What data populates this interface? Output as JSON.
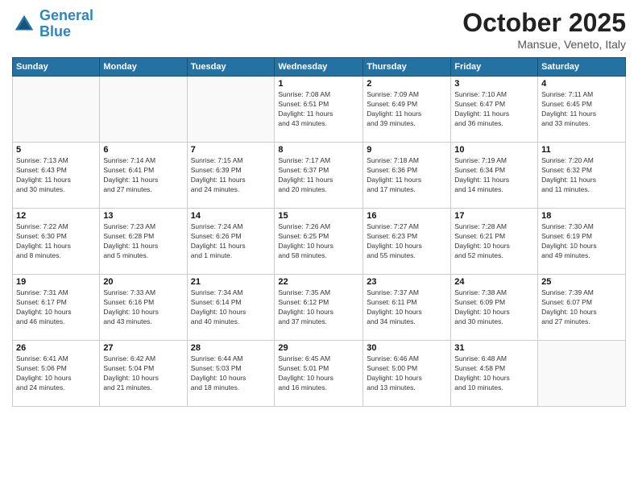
{
  "header": {
    "logo_line1": "General",
    "logo_line2": "Blue",
    "month": "October 2025",
    "location": "Mansue, Veneto, Italy"
  },
  "weekdays": [
    "Sunday",
    "Monday",
    "Tuesday",
    "Wednesday",
    "Thursday",
    "Friday",
    "Saturday"
  ],
  "weeks": [
    [
      {
        "day": "",
        "info": ""
      },
      {
        "day": "",
        "info": ""
      },
      {
        "day": "",
        "info": ""
      },
      {
        "day": "1",
        "info": "Sunrise: 7:08 AM\nSunset: 6:51 PM\nDaylight: 11 hours\nand 43 minutes."
      },
      {
        "day": "2",
        "info": "Sunrise: 7:09 AM\nSunset: 6:49 PM\nDaylight: 11 hours\nand 39 minutes."
      },
      {
        "day": "3",
        "info": "Sunrise: 7:10 AM\nSunset: 6:47 PM\nDaylight: 11 hours\nand 36 minutes."
      },
      {
        "day": "4",
        "info": "Sunrise: 7:11 AM\nSunset: 6:45 PM\nDaylight: 11 hours\nand 33 minutes."
      }
    ],
    [
      {
        "day": "5",
        "info": "Sunrise: 7:13 AM\nSunset: 6:43 PM\nDaylight: 11 hours\nand 30 minutes."
      },
      {
        "day": "6",
        "info": "Sunrise: 7:14 AM\nSunset: 6:41 PM\nDaylight: 11 hours\nand 27 minutes."
      },
      {
        "day": "7",
        "info": "Sunrise: 7:15 AM\nSunset: 6:39 PM\nDaylight: 11 hours\nand 24 minutes."
      },
      {
        "day": "8",
        "info": "Sunrise: 7:17 AM\nSunset: 6:37 PM\nDaylight: 11 hours\nand 20 minutes."
      },
      {
        "day": "9",
        "info": "Sunrise: 7:18 AM\nSunset: 6:36 PM\nDaylight: 11 hours\nand 17 minutes."
      },
      {
        "day": "10",
        "info": "Sunrise: 7:19 AM\nSunset: 6:34 PM\nDaylight: 11 hours\nand 14 minutes."
      },
      {
        "day": "11",
        "info": "Sunrise: 7:20 AM\nSunset: 6:32 PM\nDaylight: 11 hours\nand 11 minutes."
      }
    ],
    [
      {
        "day": "12",
        "info": "Sunrise: 7:22 AM\nSunset: 6:30 PM\nDaylight: 11 hours\nand 8 minutes."
      },
      {
        "day": "13",
        "info": "Sunrise: 7:23 AM\nSunset: 6:28 PM\nDaylight: 11 hours\nand 5 minutes."
      },
      {
        "day": "14",
        "info": "Sunrise: 7:24 AM\nSunset: 6:26 PM\nDaylight: 11 hours\nand 1 minute."
      },
      {
        "day": "15",
        "info": "Sunrise: 7:26 AM\nSunset: 6:25 PM\nDaylight: 10 hours\nand 58 minutes."
      },
      {
        "day": "16",
        "info": "Sunrise: 7:27 AM\nSunset: 6:23 PM\nDaylight: 10 hours\nand 55 minutes."
      },
      {
        "day": "17",
        "info": "Sunrise: 7:28 AM\nSunset: 6:21 PM\nDaylight: 10 hours\nand 52 minutes."
      },
      {
        "day": "18",
        "info": "Sunrise: 7:30 AM\nSunset: 6:19 PM\nDaylight: 10 hours\nand 49 minutes."
      }
    ],
    [
      {
        "day": "19",
        "info": "Sunrise: 7:31 AM\nSunset: 6:17 PM\nDaylight: 10 hours\nand 46 minutes."
      },
      {
        "day": "20",
        "info": "Sunrise: 7:33 AM\nSunset: 6:16 PM\nDaylight: 10 hours\nand 43 minutes."
      },
      {
        "day": "21",
        "info": "Sunrise: 7:34 AM\nSunset: 6:14 PM\nDaylight: 10 hours\nand 40 minutes."
      },
      {
        "day": "22",
        "info": "Sunrise: 7:35 AM\nSunset: 6:12 PM\nDaylight: 10 hours\nand 37 minutes."
      },
      {
        "day": "23",
        "info": "Sunrise: 7:37 AM\nSunset: 6:11 PM\nDaylight: 10 hours\nand 34 minutes."
      },
      {
        "day": "24",
        "info": "Sunrise: 7:38 AM\nSunset: 6:09 PM\nDaylight: 10 hours\nand 30 minutes."
      },
      {
        "day": "25",
        "info": "Sunrise: 7:39 AM\nSunset: 6:07 PM\nDaylight: 10 hours\nand 27 minutes."
      }
    ],
    [
      {
        "day": "26",
        "info": "Sunrise: 6:41 AM\nSunset: 5:06 PM\nDaylight: 10 hours\nand 24 minutes."
      },
      {
        "day": "27",
        "info": "Sunrise: 6:42 AM\nSunset: 5:04 PM\nDaylight: 10 hours\nand 21 minutes."
      },
      {
        "day": "28",
        "info": "Sunrise: 6:44 AM\nSunset: 5:03 PM\nDaylight: 10 hours\nand 18 minutes."
      },
      {
        "day": "29",
        "info": "Sunrise: 6:45 AM\nSunset: 5:01 PM\nDaylight: 10 hours\nand 16 minutes."
      },
      {
        "day": "30",
        "info": "Sunrise: 6:46 AM\nSunset: 5:00 PM\nDaylight: 10 hours\nand 13 minutes."
      },
      {
        "day": "31",
        "info": "Sunrise: 6:48 AM\nSunset: 4:58 PM\nDaylight: 10 hours\nand 10 minutes."
      },
      {
        "day": "",
        "info": ""
      }
    ]
  ]
}
